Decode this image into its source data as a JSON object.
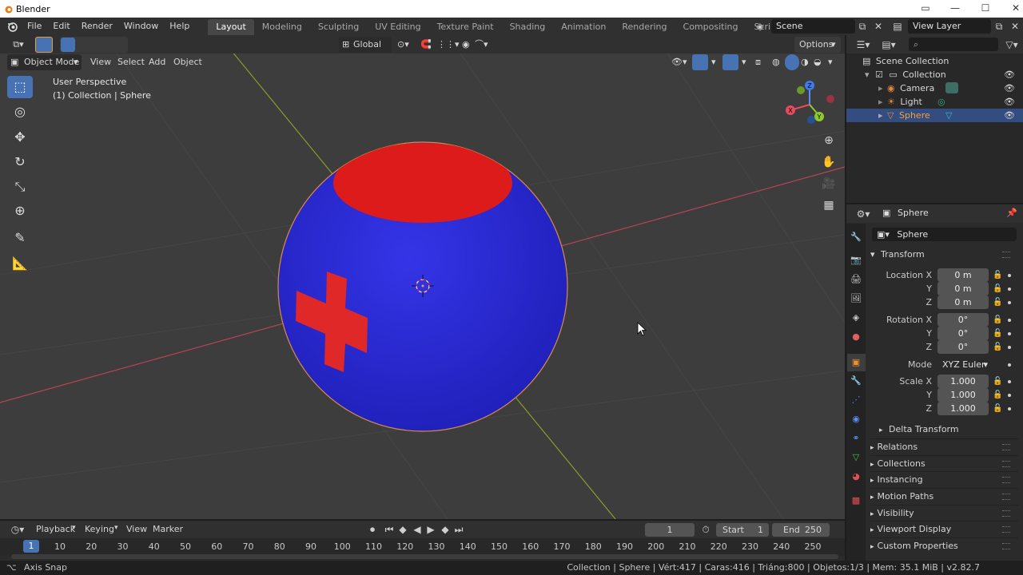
{
  "window": {
    "title": "Blender"
  },
  "menu": {
    "file": "File",
    "edit": "Edit",
    "render": "Render",
    "window": "Window",
    "help": "Help"
  },
  "workspaces": [
    "Layout",
    "Modeling",
    "Sculpting",
    "UV Editing",
    "Texture Paint",
    "Shading",
    "Animation",
    "Rendering",
    "Compositing",
    "Scripting"
  ],
  "top_right": {
    "scene": "Scene",
    "view_layer": "View Layer"
  },
  "tool_header": {
    "orientation": "Global",
    "options": "Options"
  },
  "viewport_header": {
    "mode": "Object Mode",
    "view": "View",
    "select": "Select",
    "add": "Add",
    "object": "Object"
  },
  "viewport": {
    "perspective": "User Perspective",
    "context": "(1) Collection | Sphere"
  },
  "gizmo": {
    "x": "X",
    "y": "Y",
    "z": "Z"
  },
  "outliner": {
    "scene_collection": "Scene Collection",
    "collection": "Collection",
    "items": [
      "Camera",
      "Light",
      "Sphere"
    ]
  },
  "properties": {
    "object_name": "Sphere",
    "datablock": "Sphere",
    "transform": {
      "title": "Transform",
      "location_label": "Location X",
      "y_label": "Y",
      "z_label": "Z",
      "location": [
        "0 m",
        "0 m",
        "0 m"
      ],
      "rotation_label": "Rotation X",
      "rotation": [
        "0°",
        "0°",
        "0°"
      ],
      "mode_label": "Mode",
      "mode": "XYZ Euler",
      "scale_label": "Scale X",
      "scale": [
        "1.000",
        "1.000",
        "1.000"
      ],
      "delta": "Delta Transform"
    },
    "panels": [
      "Relations",
      "Collections",
      "Instancing",
      "Motion Paths",
      "Visibility",
      "Viewport Display",
      "Custom Properties"
    ]
  },
  "timeline": {
    "playback": "Playback",
    "keying": "Keying",
    "view": "View",
    "marker": "Marker",
    "current_frame": "1",
    "start_label": "Start",
    "start": "1",
    "end_label": "End",
    "end": "250",
    "ruler": [
      "10",
      "20",
      "30",
      "40",
      "50",
      "60",
      "70",
      "80",
      "90",
      "100",
      "110",
      "120",
      "130",
      "140",
      "150",
      "160",
      "170",
      "180",
      "190",
      "200",
      "210",
      "220",
      "230",
      "240",
      "250"
    ],
    "ruler_current": "1"
  },
  "status": {
    "left": "Axis Snap",
    "right": "Collection | Sphere | Vért:417 | Caras:416 | Triáng:800 | Objetos:1/3 | Mem: 35.1 MiB | v2.82.7"
  },
  "colors": {
    "sphere_blue": "#2f2fd6",
    "sphere_red": "#e02020",
    "accent": "#4772b3",
    "selection": "#334d80"
  }
}
